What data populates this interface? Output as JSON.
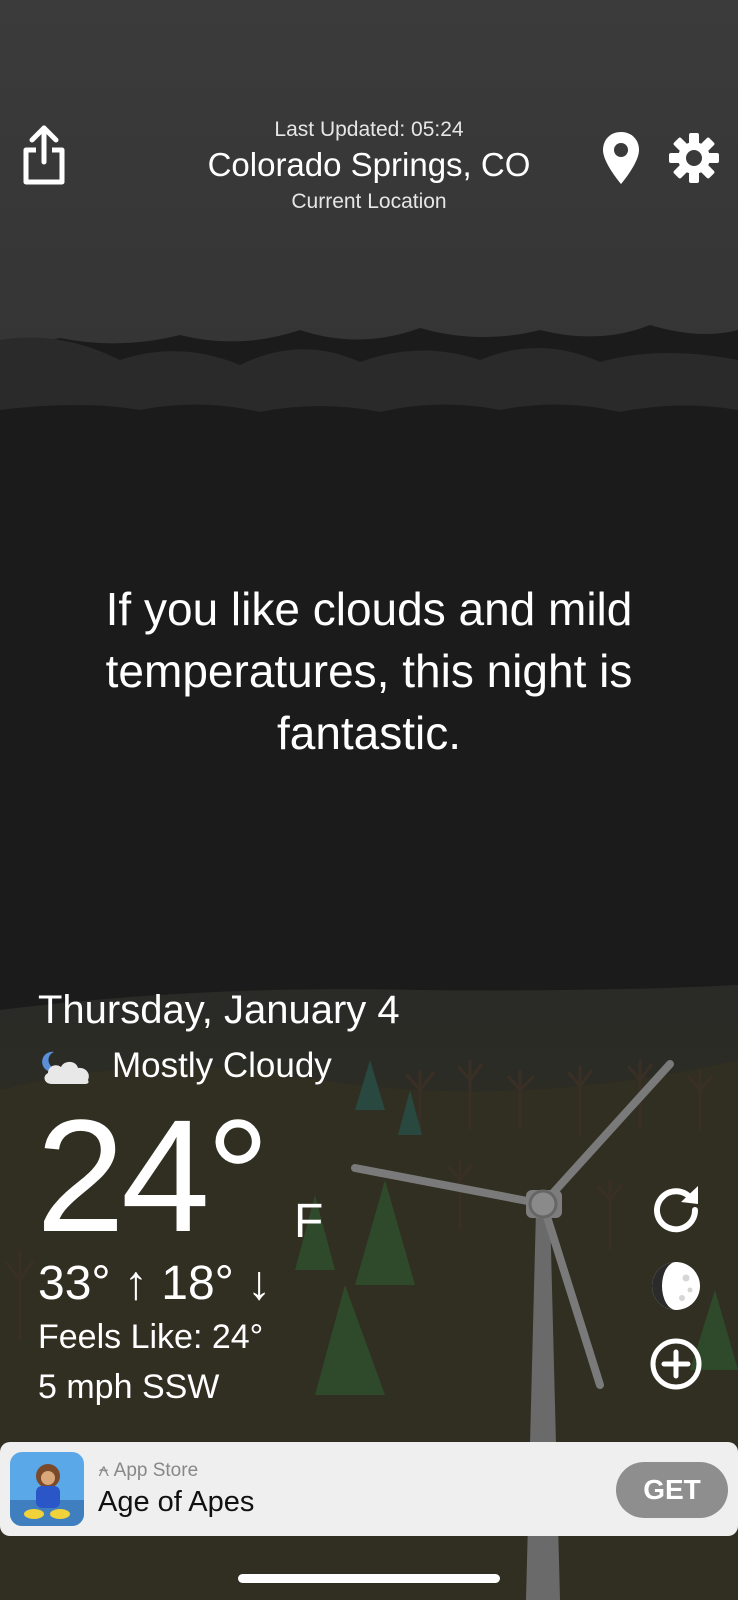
{
  "header": {
    "last_updated": "Last Updated: 05:24",
    "city": "Colorado Springs, CO",
    "location_label": "Current Location",
    "share_icon": "share-icon",
    "location_icon": "location-pin-icon",
    "settings_icon": "gear-icon"
  },
  "quip": {
    "text": "If you like clouds and mild temperatures, this night is fantastic."
  },
  "weather": {
    "date": "Thursday, January 4",
    "condition": "Mostly Cloudy",
    "condition_icon": "night-cloudy-icon",
    "temperature": "24°",
    "unit": "F",
    "high_low": "33° ↑ 18° ↓",
    "feels_like": "Feels Like: 24°",
    "wind": "5 mph SSW"
  },
  "side_buttons": [
    {
      "icon": "refresh-icon"
    },
    {
      "icon": "moon-phase-icon"
    },
    {
      "icon": "add-icon"
    }
  ],
  "ad": {
    "store": "App Store",
    "title": "Age of Apes",
    "cta": "GET"
  },
  "colors": {
    "sky_top": "#3a3a3a",
    "sky_night": "#1b1b1b",
    "ground": "#2f2d22",
    "tree_green": "#2e4a2a",
    "ad_bg": "#efefef",
    "get_button": "#8e8e8e"
  }
}
